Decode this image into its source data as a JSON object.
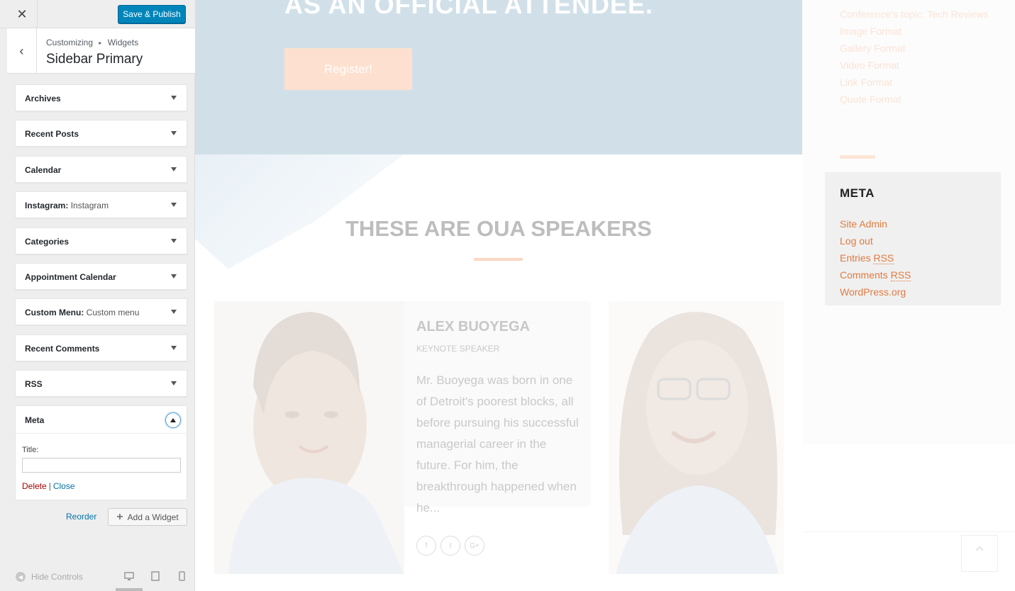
{
  "customizer": {
    "close_glyph": "✕",
    "publish_label": "Save & Publish",
    "back_glyph": "‹",
    "breadcrumb": [
      "Customizing",
      "Widgets"
    ],
    "breadcrumb_separator": "▸",
    "section_title": "Sidebar Primary",
    "widgets": [
      {
        "title": "Archives",
        "subtitle": ""
      },
      {
        "title": "Recent Posts",
        "subtitle": ""
      },
      {
        "title": "Calendar",
        "subtitle": ""
      },
      {
        "title": "Instagram:",
        "subtitle": "Instagram"
      },
      {
        "title": "Categories",
        "subtitle": ""
      },
      {
        "title": "Appointment Calendar",
        "subtitle": ""
      },
      {
        "title": "Custom Menu:",
        "subtitle": "Custom menu"
      },
      {
        "title": "Recent Comments",
        "subtitle": ""
      },
      {
        "title": "RSS",
        "subtitle": ""
      }
    ],
    "expanded_widget": {
      "title": "Meta",
      "field_label": "Title:",
      "field_value": "",
      "delete_label": "Delete",
      "separator": "|",
      "close_label": "Close"
    },
    "reorder_label": "Reorder",
    "add_widget_label": "Add a Widget",
    "add_widget_glyph": "+",
    "hide_controls_label": "Hide Controls",
    "active_device": "desktop",
    "colors": {
      "publish": "#0085ba",
      "delete": "#a00",
      "link": "#0073aa"
    }
  },
  "preview": {
    "hero_heading": "AS AN OFFICIAL ATTENDEE.",
    "register_label": "Register!",
    "speakers_heading": "THESE ARE OUA SPEAKERS",
    "speaker": {
      "name": "ALEX BUOYEGA",
      "role": "KEYNOTE SPEAKER",
      "bio": "Mr. Buoyega was born in one of Detroit's poorest blocks, all before pursuing his successful managerial career in the future. For him, the breakthrough happened when he..."
    },
    "social": [
      "f",
      "t",
      "G+"
    ],
    "recent_posts": [
      "Conference's topic: Tech Reviews",
      "Image Format",
      "Gallery Format",
      "Video Format",
      "Link Format",
      "Quote Format"
    ],
    "meta_widget": {
      "title": "META",
      "links": [
        {
          "text": "Site Admin",
          "abbr": ""
        },
        {
          "text": "Log out",
          "abbr": ""
        },
        {
          "text": "Entries ",
          "abbr": "RSS"
        },
        {
          "text": "Comments ",
          "abbr": "RSS"
        },
        {
          "text": "WordPress.org",
          "abbr": ""
        }
      ]
    },
    "back_to_top_glyph": "⌃",
    "colors": {
      "accent": "#e07b3f",
      "hero_bg": "#d1e0e8"
    }
  }
}
